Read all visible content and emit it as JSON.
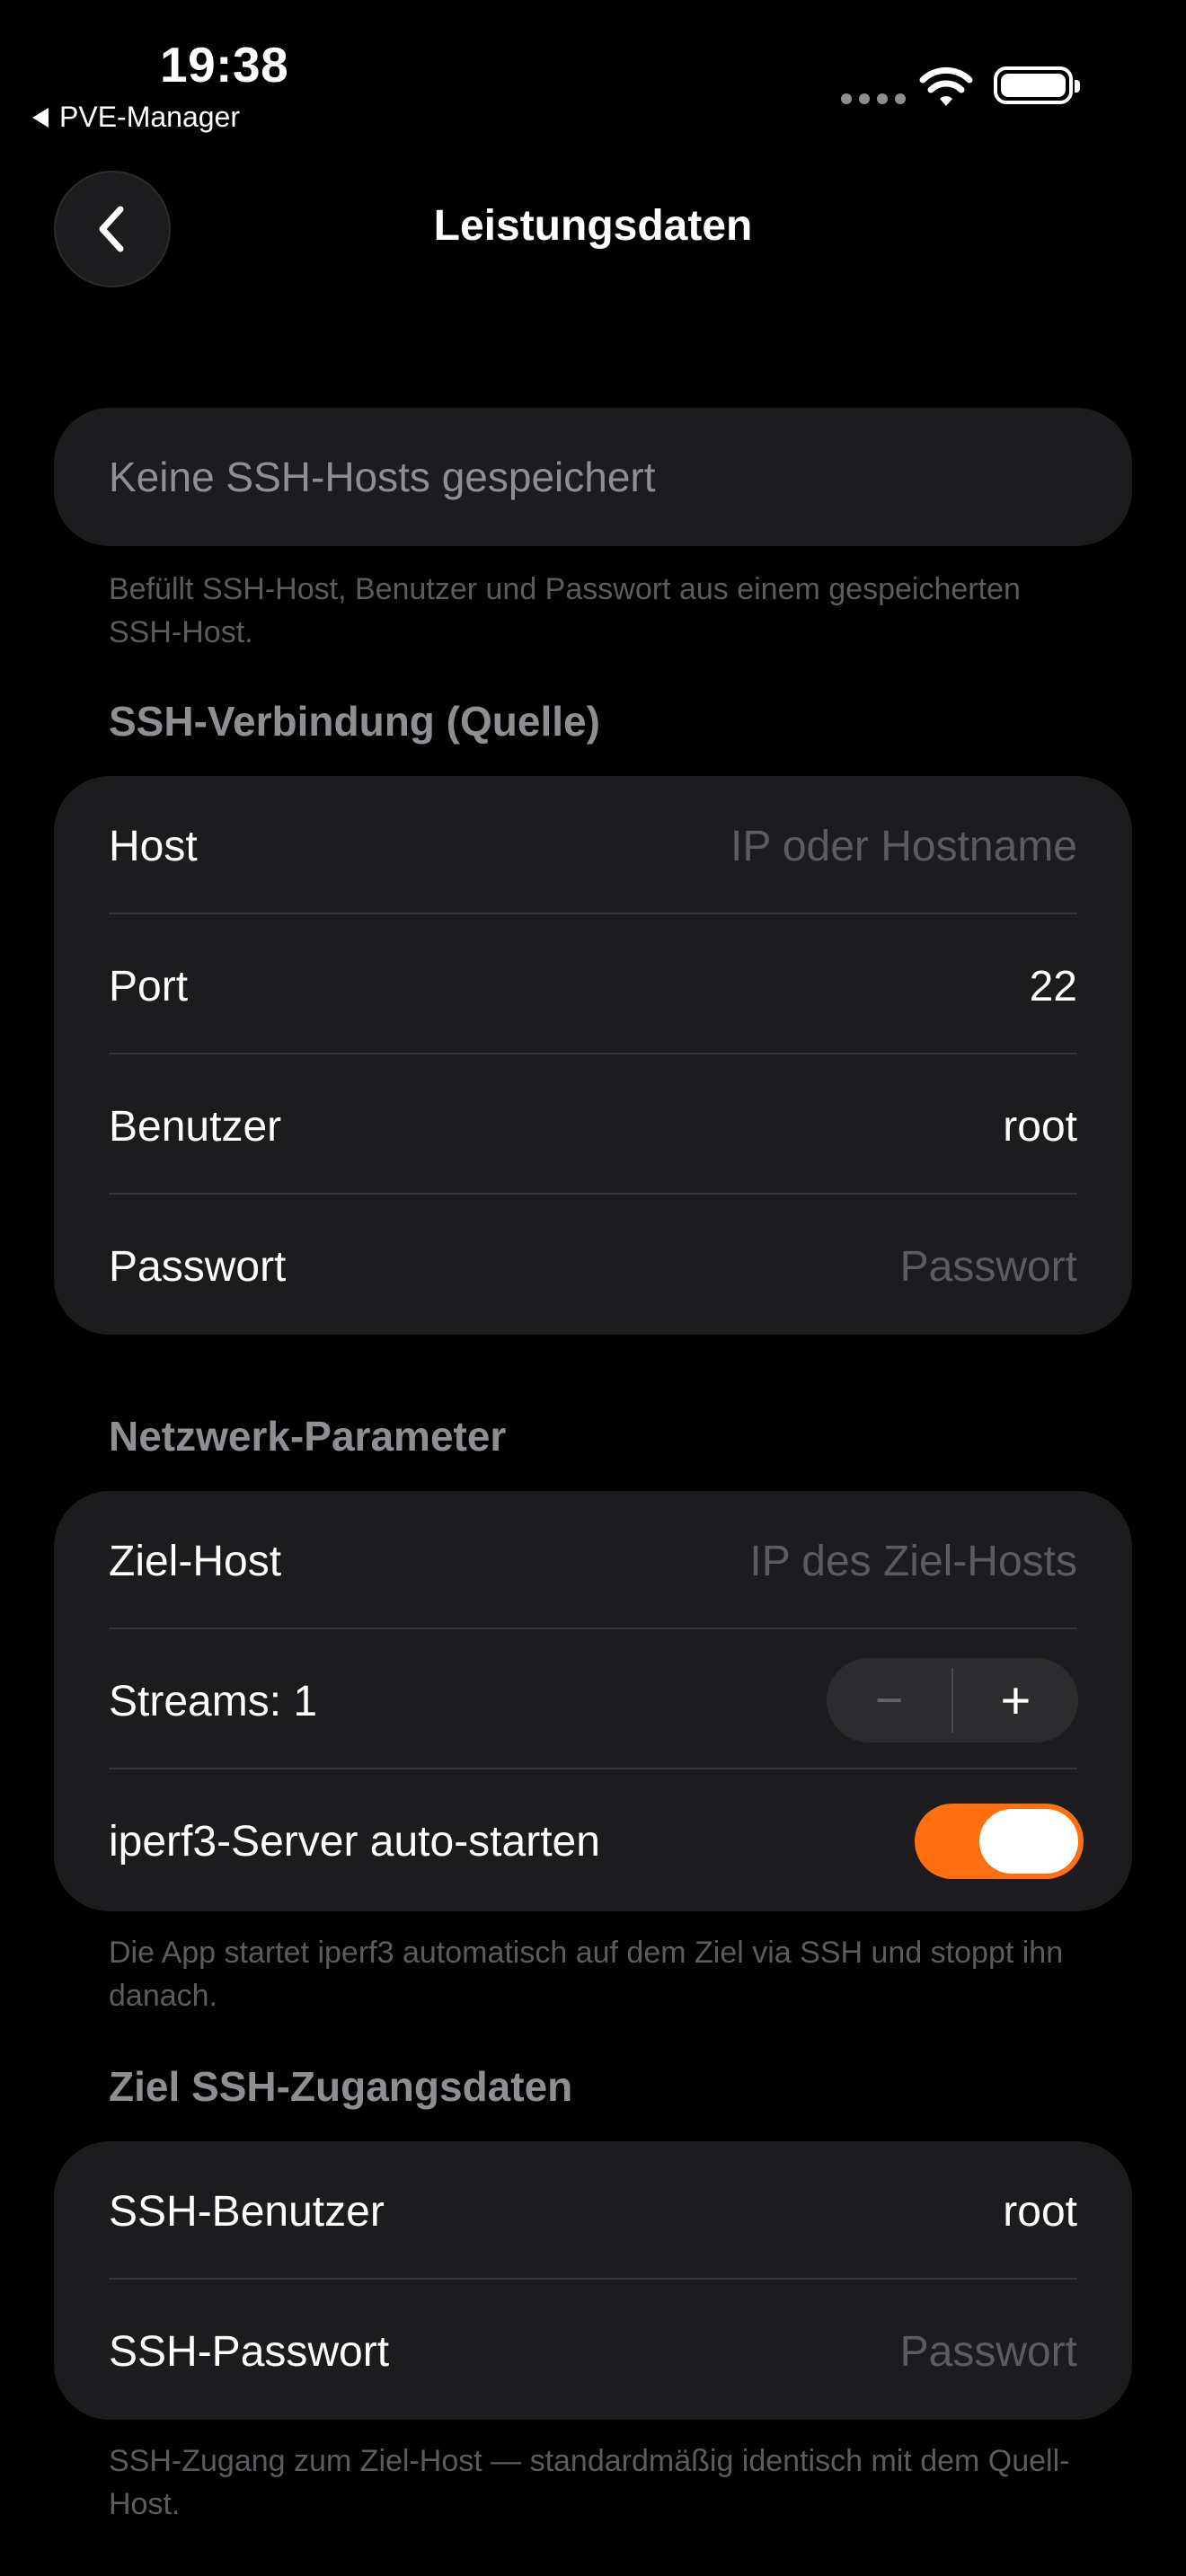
{
  "status_bar": {
    "time": "19:38",
    "back_app": "PVE-Manager"
  },
  "nav": {
    "title": "Leistungsdaten"
  },
  "ssh_host_picker": {
    "label": "Keine SSH-Hosts gespeichert",
    "footnote": "Befüllt SSH-Host, Benutzer und Passwort aus einem gespeicherten SSH-Host."
  },
  "source_section": {
    "header": "SSH-Verbindung (Quelle)",
    "rows": [
      {
        "label": "Host",
        "value": "",
        "placeholder": "IP oder Hostname"
      },
      {
        "label": "Port",
        "value": "22",
        "placeholder": ""
      },
      {
        "label": "Benutzer",
        "value": "root",
        "placeholder": ""
      },
      {
        "label": "Passwort",
        "value": "",
        "placeholder": "Passwort"
      }
    ]
  },
  "network_section": {
    "header": "Netzwerk-Parameter",
    "target_host": {
      "label": "Ziel-Host",
      "placeholder": "IP des Ziel-Hosts"
    },
    "streams": {
      "label": "Streams: 1",
      "minus": "−",
      "plus": "+"
    },
    "autostart": {
      "label": "iperf3-Server auto-starten",
      "on": true
    },
    "footnote": "Die App startet iperf3 automatisch auf dem Ziel via SSH und stoppt ihn danach."
  },
  "target_section": {
    "header": "Ziel SSH-Zugangsdaten",
    "rows": [
      {
        "label": "SSH-Benutzer",
        "value": "root",
        "placeholder": ""
      },
      {
        "label": "SSH-Passwort",
        "value": "",
        "placeholder": "Passwort"
      }
    ],
    "footnote": "SSH-Zugang zum Ziel-Host — standardmäßig identisch mit dem Quell-Host."
  },
  "colors": {
    "accent": "#ff6f0f",
    "card": "#1c1c1e",
    "secondary_text": "#8e8e93"
  }
}
